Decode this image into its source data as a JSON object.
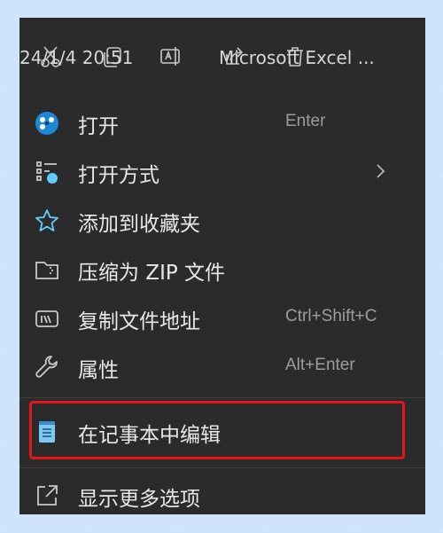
{
  "toolbar": {
    "date": "24/1/4 20:51",
    "app": "Microsoft Excel ...",
    "icons": [
      "cut-icon",
      "copy-icon",
      "rename-icon",
      "share-icon",
      "delete-icon"
    ]
  },
  "menu": {
    "items": [
      {
        "label": "打开",
        "shortcut": "Enter",
        "icon": "open-icon"
      },
      {
        "label": "打开方式",
        "shortcut": "",
        "icon": "open-with-icon",
        "has_submenu": true
      },
      {
        "label": "添加到收藏夹",
        "shortcut": "",
        "icon": "star-icon"
      },
      {
        "label": "压缩为 ZIP 文件",
        "shortcut": "",
        "icon": "zip-icon"
      },
      {
        "label": "复制文件地址",
        "shortcut": "Ctrl+Shift+C",
        "icon": "copy-path-icon"
      },
      {
        "label": "属性",
        "shortcut": "Alt+Enter",
        "icon": "wrench-icon"
      },
      {
        "label": "在记事本中编辑",
        "shortcut": "",
        "icon": "notepad-icon",
        "highlighted": true
      },
      {
        "label": "显示更多选项",
        "shortcut": "",
        "icon": "show-more-icon"
      }
    ]
  },
  "colors": {
    "menu_bg": "#2b2b2b",
    "highlight_border": "#e5161a",
    "accent_icon": "#60cdff"
  }
}
